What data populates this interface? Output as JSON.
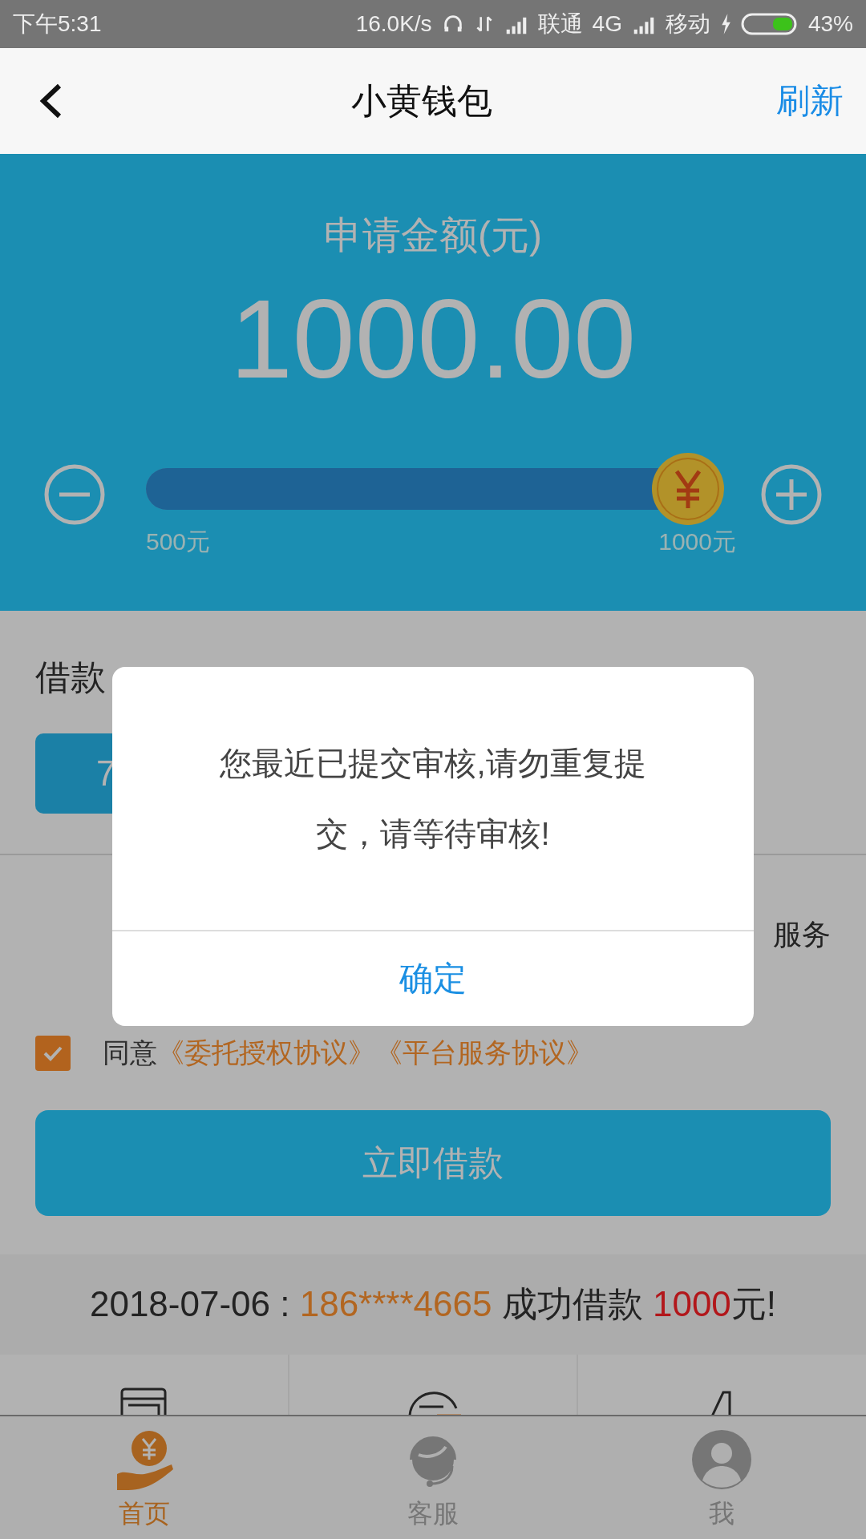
{
  "status_bar": {
    "time": "下午5:31",
    "net_speed": "16.0K/s",
    "carrier_1": "联通",
    "network_1": "4G",
    "carrier_2": "移动",
    "battery": "43%"
  },
  "nav": {
    "title": "小黄钱包",
    "action": "刷新"
  },
  "amount": {
    "label": "申请金额(元)",
    "value": "1000.00",
    "slider": {
      "level": 1,
      "min_label": "500元",
      "max_label": "1000元"
    }
  },
  "term": {
    "label": "借款",
    "options": [
      {
        "label": "7",
        "selected": true
      }
    ]
  },
  "service_note": "服务",
  "agreement": {
    "checked": true,
    "text": "同意",
    "links": [
      "《委托授权协议》",
      "《平台服务协议》"
    ]
  },
  "submit": "立即借款",
  "notice": [
    {
      "kind": "plain",
      "text": "2018-07-06 : "
    },
    {
      "kind": "phone",
      "text": "186****4665"
    },
    {
      "kind": "plain",
      "text": " 成功借款 "
    },
    {
      "kind": "amount",
      "text": "1000"
    },
    {
      "kind": "plain",
      "text": "元!"
    }
  ],
  "tabs": [
    {
      "label": "首页",
      "kind": "home",
      "selected": true
    },
    {
      "label": "客服",
      "kind": "service",
      "selected": false
    },
    {
      "label": "我",
      "kind": "me",
      "selected": false
    }
  ],
  "dialog": {
    "message": "您最近已提交审核,请勿重复提交，请等待审核!",
    "button": "确定"
  }
}
